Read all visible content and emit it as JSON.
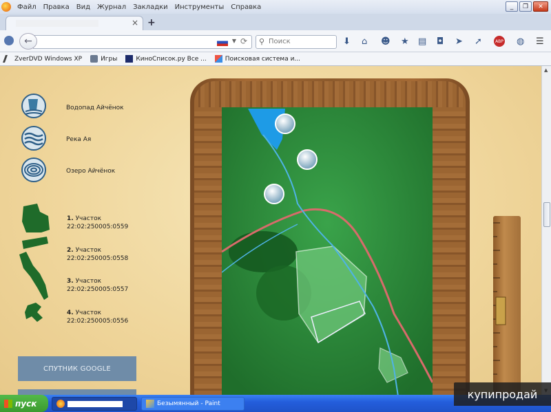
{
  "menu": [
    "Файл",
    "Правка",
    "Вид",
    "Журнал",
    "Закладки",
    "Инструменты",
    "Справка"
  ],
  "tab": {
    "close": "×",
    "new": "+"
  },
  "nav": {
    "search_placeholder": "Поиск"
  },
  "bookmarks": [
    {
      "label": "ZverDVD Windows XP",
      "icon": "pencil-icon"
    },
    {
      "label": "Игры",
      "icon": "bookmark-icon"
    },
    {
      "label": "КиноСписок.ру Все ...",
      "icon": "film-icon"
    },
    {
      "label": "Поисковая система и...",
      "icon": "image-icon"
    }
  ],
  "legend": {
    "waterfall": "Водопад Айчёнок",
    "river": "Река Ая",
    "lake": "Озеро Айчёнок"
  },
  "plots": [
    {
      "num": "1.",
      "label": "Участок",
      "cadastre": "22:02:250005:0559"
    },
    {
      "num": "2.",
      "label": "Участок",
      "cadastre": "22:02:250005:0558"
    },
    {
      "num": "3.",
      "label": "Участок",
      "cadastre": "22:02:250005:0557"
    },
    {
      "num": "4.",
      "label": "Участок",
      "cadastre": "22:02:250005:0556"
    }
  ],
  "google_button": "СПУТНИК GOOGLE",
  "taskbar": {
    "start": "пуск",
    "paint": "Безымянный - Paint"
  },
  "watermark": "купипродай",
  "colors": {
    "map_green": "#2e8f3a",
    "road": "#d86b6b",
    "river": "#4fb3e6",
    "button": "#6f8ca8"
  }
}
